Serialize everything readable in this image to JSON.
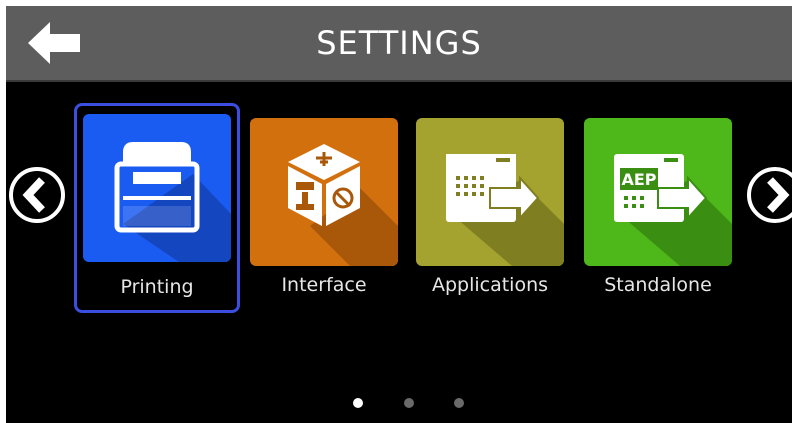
{
  "header": {
    "title": "SETTINGS",
    "back_icon": "left-arrow-icon"
  },
  "navigation": {
    "prev_icon": "chevron-left-circle-icon",
    "next_icon": "chevron-right-circle-icon"
  },
  "tiles": [
    {
      "label": "Printing",
      "icon": "printer-icon",
      "color": "#1a5cf2",
      "selected": true
    },
    {
      "label": "Interface",
      "icon": "usb-network-cube-icon",
      "color": "#d2700e",
      "selected": false
    },
    {
      "label": "Applications",
      "icon": "window-arrow-icon",
      "color": "#a4a32f",
      "selected": false
    },
    {
      "label": "Standalone",
      "icon": "aep-window-arrow-icon",
      "color": "#4eb81b",
      "selected": false,
      "badge": "AEP"
    }
  ],
  "pagination": {
    "pages": 3,
    "current": 1
  },
  "colors": {
    "selection_border": "#3b4ee0",
    "header_bg": "#5d5d5d",
    "screen_bg": "#000000"
  }
}
